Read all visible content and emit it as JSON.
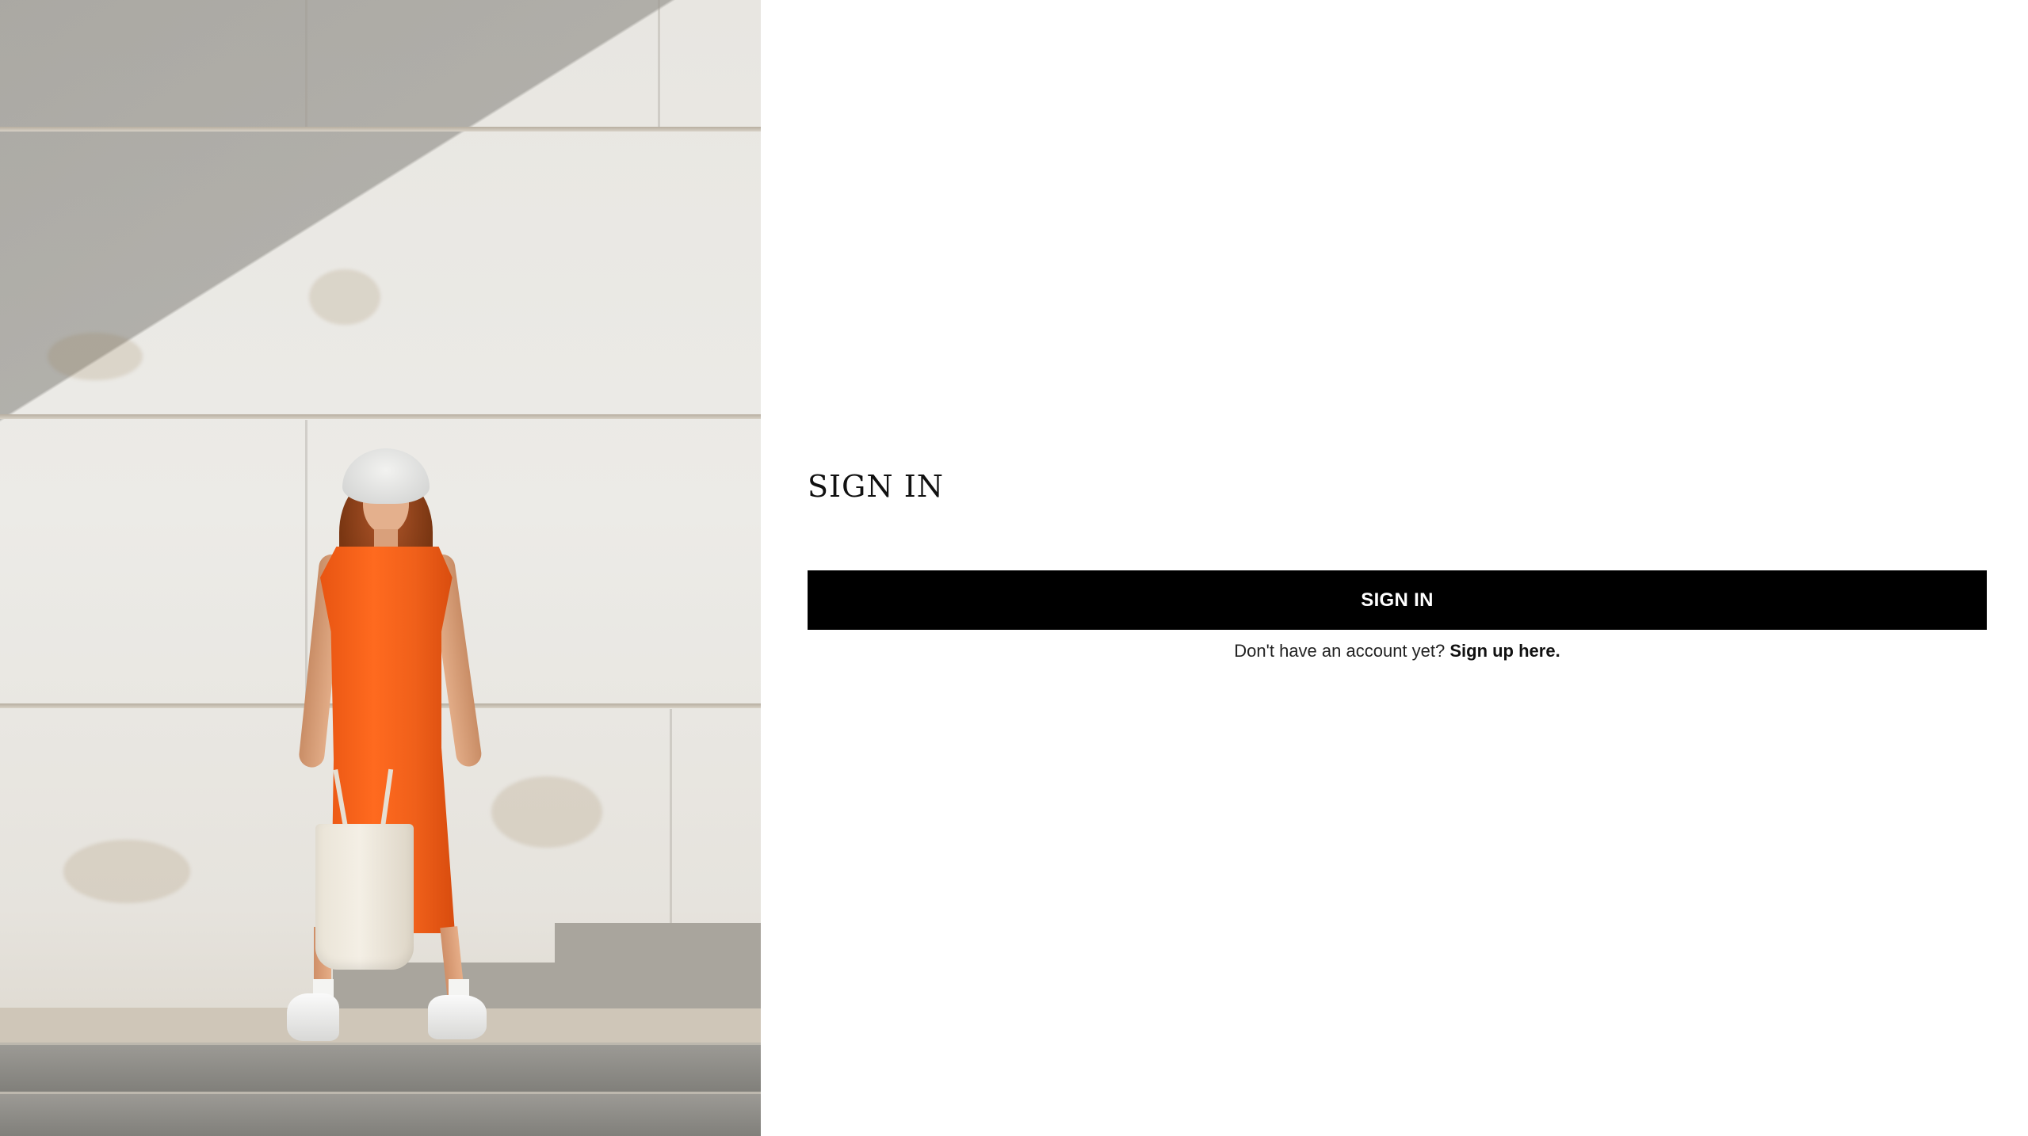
{
  "hero": {
    "image_icon": "photo-model-orange-dress"
  },
  "form": {
    "title": "SIGN IN",
    "signin_button_label": "SIGN IN",
    "signup_prompt": "Don't have an account yet?",
    "signup_link_label": "Sign up here."
  },
  "colors": {
    "button_bg": "#000000",
    "button_text": "#ffffff",
    "page_bg": "#ffffff",
    "text": "#111111"
  }
}
